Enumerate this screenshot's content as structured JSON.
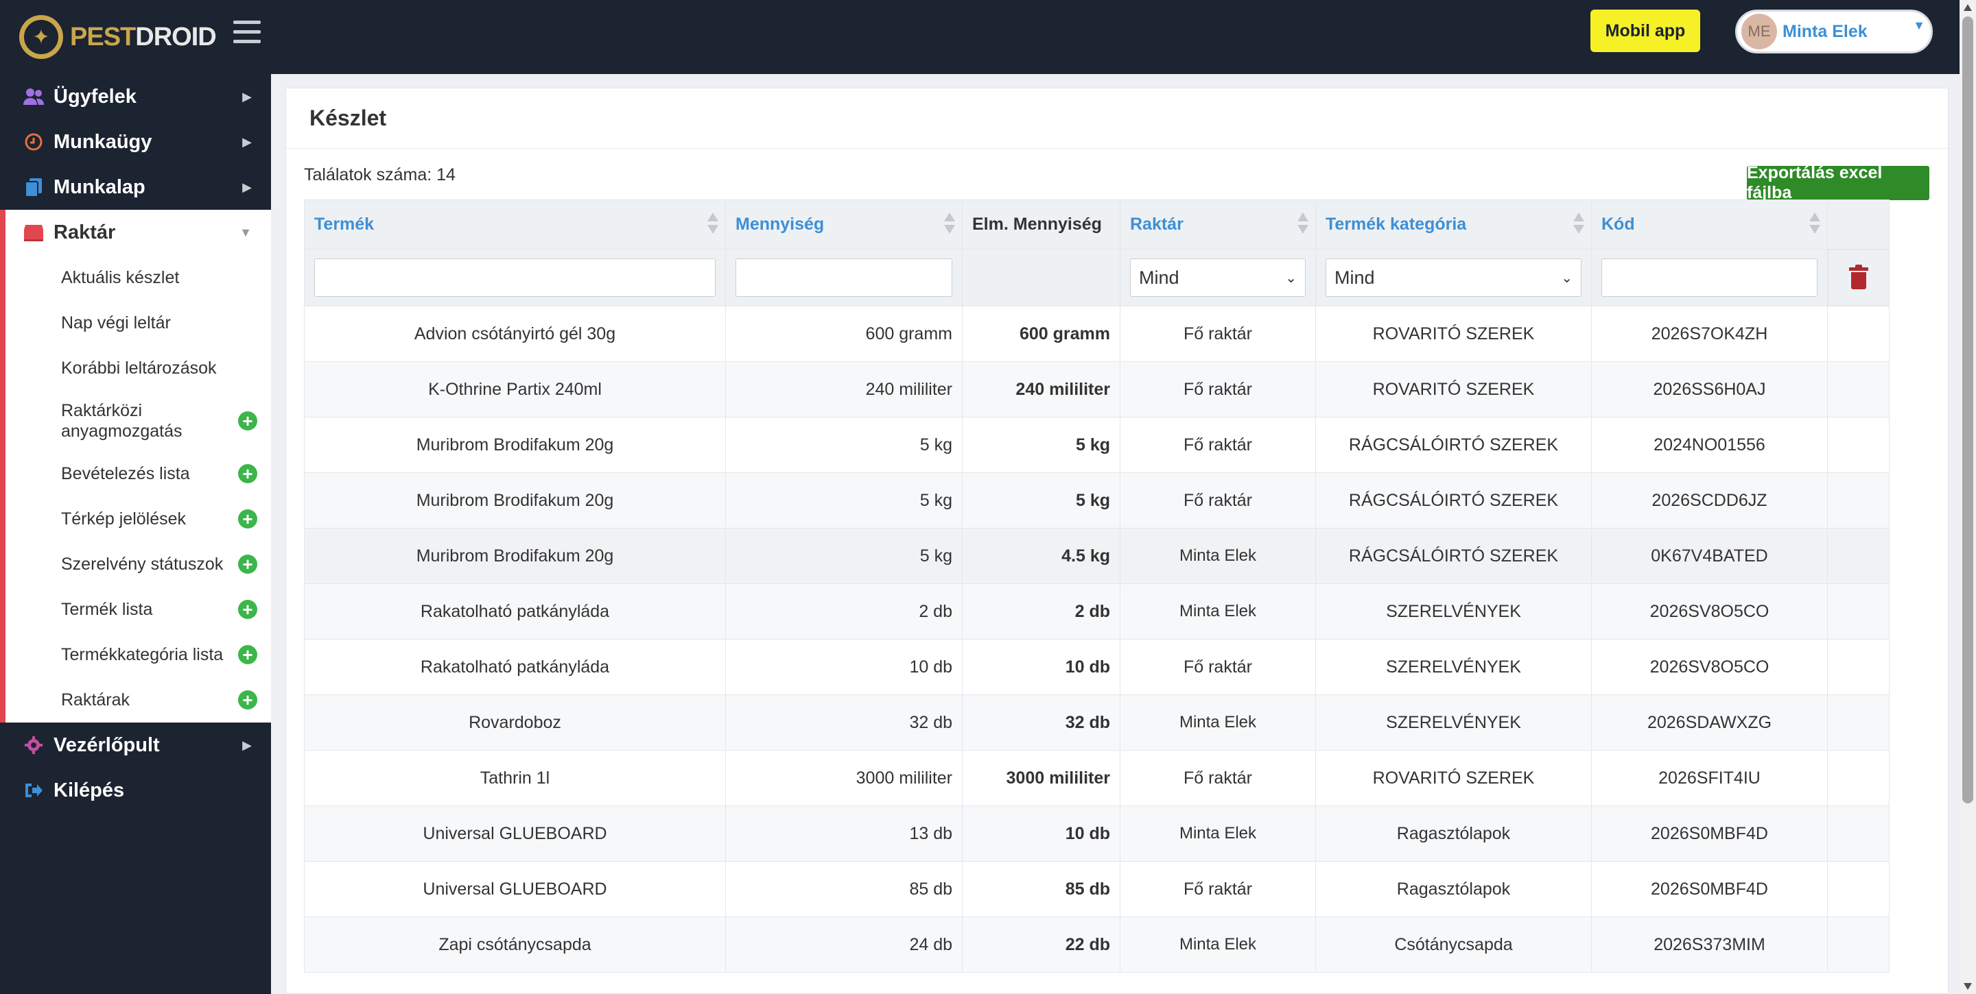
{
  "brand": {
    "logo_part1": "PEST",
    "logo_part2": "DROID"
  },
  "header": {
    "mobile_app_label": "Mobil app",
    "user_initials": "ME",
    "user_name": "Minta Elek"
  },
  "sidebar": {
    "items": [
      {
        "label": "Ügyfelek",
        "icon": "users-icon"
      },
      {
        "label": "Munkaügy",
        "icon": "clock-icon"
      },
      {
        "label": "Munkalap",
        "icon": "copy-icon"
      },
      {
        "label": "Raktár",
        "icon": "warehouse-icon"
      },
      {
        "label": "Vezérlőpult",
        "icon": "gear-icon"
      },
      {
        "label": "Kilépés",
        "icon": "logout-icon"
      }
    ],
    "raktar_sub": [
      "Aktuális készlet",
      "Nap végi leltár",
      "Korábbi leltározások",
      "Raktárközi anyagmozgatás",
      "Bevételezés lista",
      "Térkép jelölések",
      "Szerelvény státuszok",
      "Termék lista",
      "Termékkategória lista",
      "Raktárak"
    ]
  },
  "page": {
    "title": "Készlet",
    "count_text": "Találatok száma: 14",
    "export_label": "Exportálás excel fájlba"
  },
  "table": {
    "columns": [
      "Termék",
      "Mennyiség",
      "Elm. Mennyiség",
      "Raktár",
      "Termék kategória",
      "Kód"
    ],
    "filters": {
      "raktar": "Mind",
      "kategoria": "Mind"
    },
    "rows": [
      [
        "Advion csótányirtó gél 30g",
        "600 gramm",
        "600 gramm",
        "Fő raktár",
        "ROVARITÓ SZEREK",
        "2026S7OK4ZH"
      ],
      [
        "K-Othrine Partix 240ml",
        "240 mililiter",
        "240 mililiter",
        "Fő raktár",
        "ROVARITÓ SZEREK",
        "2026SS6H0AJ"
      ],
      [
        "Muribrom Brodifakum 20g",
        "5 kg",
        "5 kg",
        "Fő raktár",
        "RÁGCSÁLÓIRTÓ SZEREK",
        "2024NO01556"
      ],
      [
        "Muribrom Brodifakum 20g",
        "5 kg",
        "5 kg",
        "Fő raktár",
        "RÁGCSÁLÓIRTÓ SZEREK",
        "2026SCDD6JZ"
      ],
      [
        "Muribrom Brodifakum 20g",
        "5 kg",
        "4.5 kg",
        "Minta Elek",
        "RÁGCSÁLÓIRTÓ SZEREK",
        "0K67V4BATED"
      ],
      [
        "Rakatolható patkányláda",
        "2 db",
        "2 db",
        "Minta Elek",
        "SZERELVÉNYEK",
        "2026SV8O5CO"
      ],
      [
        "Rakatolható patkányláda",
        "10 db",
        "10 db",
        "Fő raktár",
        "SZERELVÉNYEK",
        "2026SV8O5CO"
      ],
      [
        "Rovardoboz",
        "32 db",
        "32 db",
        "Minta Elek",
        "SZERELVÉNYEK",
        "2026SDAWXZG"
      ],
      [
        "Tathrin 1l",
        "3000 mililiter",
        "3000 mililiter",
        "Fő raktár",
        "ROVARITÓ SZEREK",
        "2026SFIT4IU"
      ],
      [
        "Universal GLUEBOARD",
        "13 db",
        "10 db",
        "Minta Elek",
        "Ragasztólapok",
        "2026S0MBF4D"
      ],
      [
        "Universal GLUEBOARD",
        "85 db",
        "85 db",
        "Fő raktár",
        "Ragasztólapok",
        "2026S0MBF4D"
      ],
      [
        "Zapi csótánycsapda",
        "24 db",
        "22 db",
        "Minta Elek",
        "Csótánycsapda",
        "2026S373MIM"
      ]
    ]
  }
}
